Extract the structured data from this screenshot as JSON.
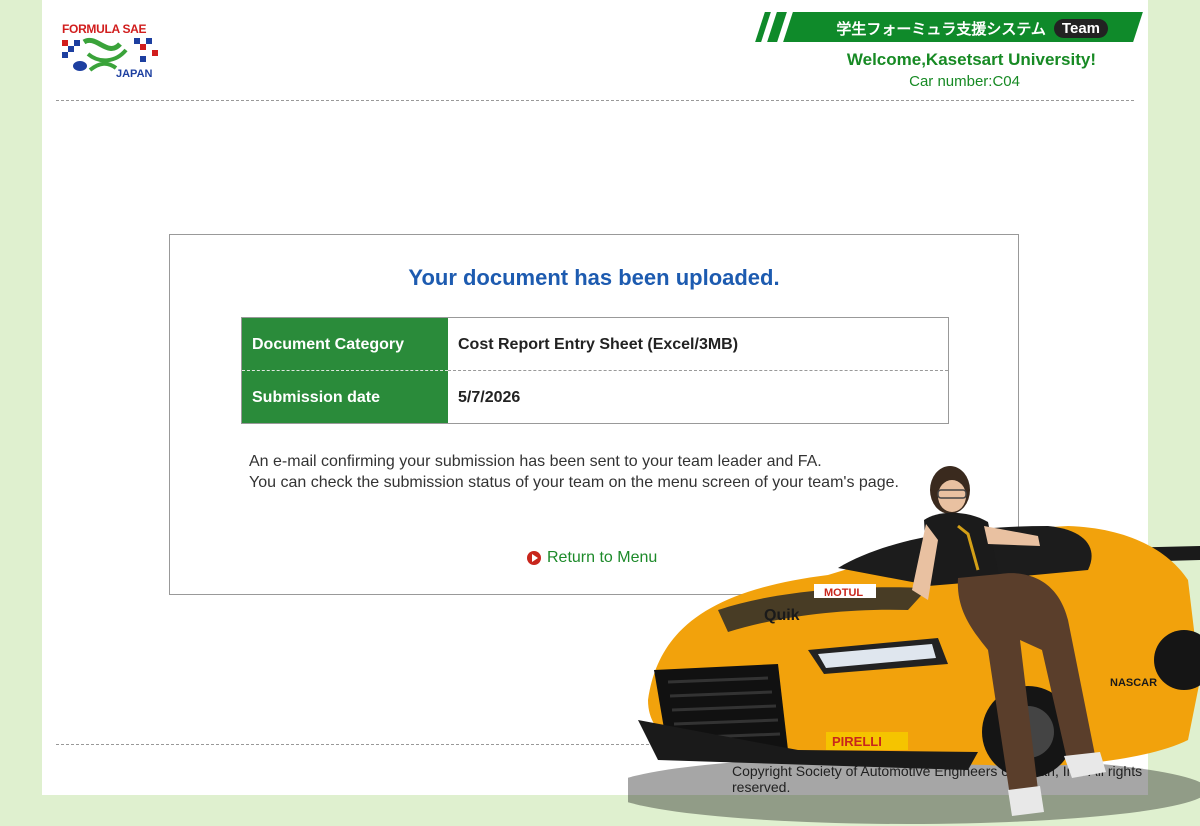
{
  "header": {
    "logo_top": "FORMULA SAE",
    "logo_bottom": "JAPAN",
    "system_title": "学生フォーミュラ支援システム",
    "team_badge": "Team",
    "welcome": "Welcome,Kasetsart University!",
    "car_number": "Car number:C04"
  },
  "main": {
    "heading": "Your document has been uploaded.",
    "rows": [
      {
        "label": "Document Category",
        "value": "Cost Report Entry Sheet (Excel/3MB)"
      },
      {
        "label": "Submission date",
        "value": "5/7/2026"
      }
    ],
    "message_line1": "An e-mail confirming your submission has been sent to your team leader and FA.",
    "message_line2": "You can check the submission status of your team on the menu screen of your team's page.",
    "return_label": "Return to Menu"
  },
  "footer": {
    "copyright": "Copyright Society of Automotive Engineers of Japan, Inc. All rights reserved."
  },
  "photo": {
    "car_sponsors": [
      "MOTUL",
      "Quik",
      "PIRELLI",
      "NASCAR"
    ]
  },
  "colors": {
    "brand_green": "#178a24",
    "heading_blue": "#1d5bb0",
    "page_background": "#dff0cf",
    "car_orange": "#f2a20c"
  }
}
